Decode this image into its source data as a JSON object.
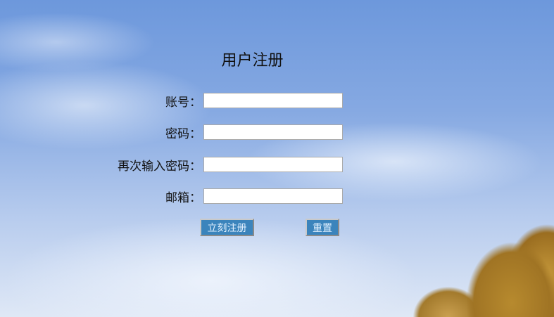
{
  "title": "用户注册",
  "fields": [
    {
      "label": "账号：",
      "value": ""
    },
    {
      "label": "密码：",
      "value": ""
    },
    {
      "label": "再次输入密码：",
      "value": ""
    },
    {
      "label": "邮箱：",
      "value": ""
    }
  ],
  "buttons": {
    "submit": "立刻注册",
    "reset": "重置"
  }
}
